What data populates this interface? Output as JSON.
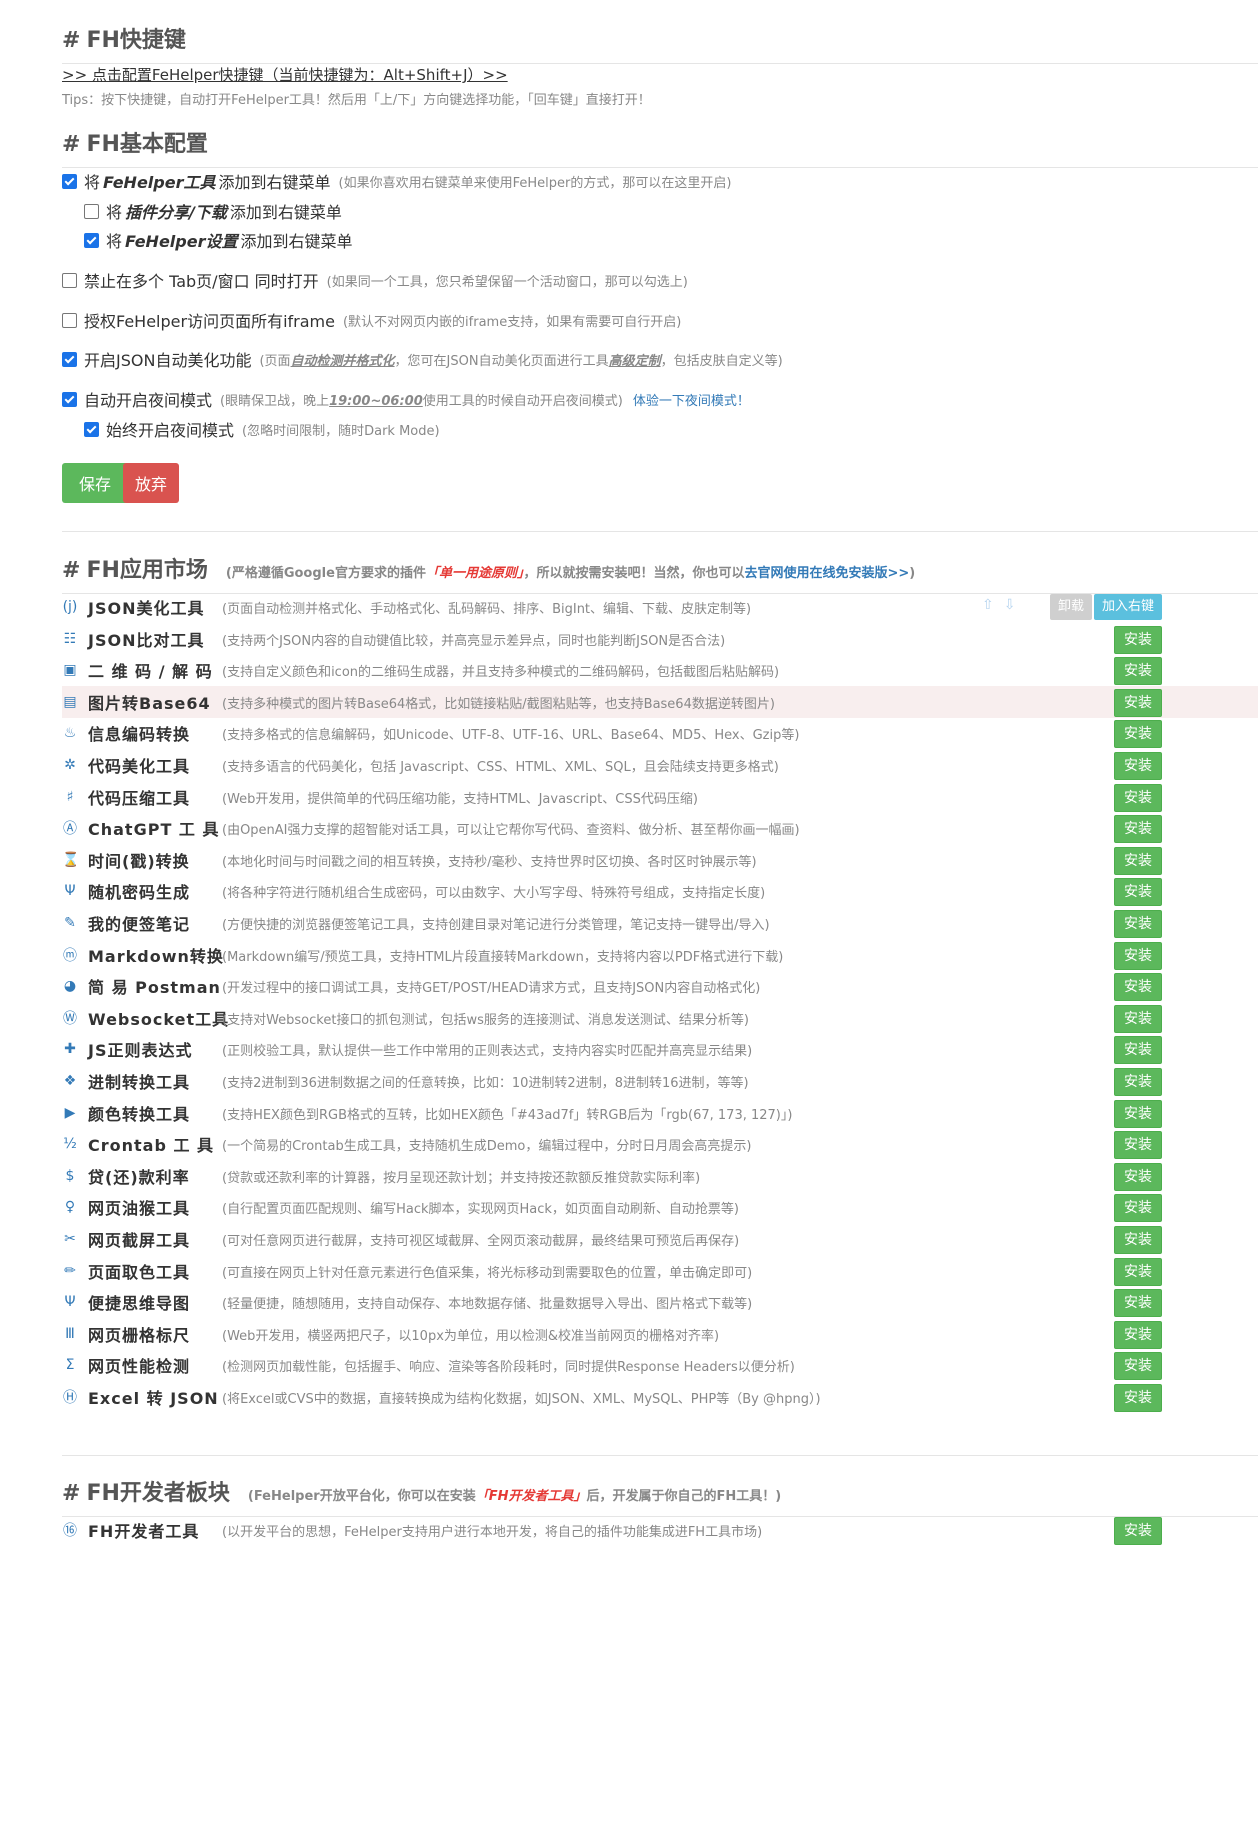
{
  "hotkey": {
    "header_title": "FH快捷键",
    "link": ">> 点击配置FeHelper快捷键（当前快捷键为：Alt+Shift+J）>>",
    "tips": "Tips：按下快捷键，自动打开FeHelper工具！然后用「上/下」方向键选择功能，「回车键」直接打开！"
  },
  "basic": {
    "header_title": "FH基本配置",
    "options": {
      "ctx_menu": {
        "checked": true,
        "pre": "将",
        "em": "FeHelper工具",
        "post": "添加到右键菜单",
        "note": "(如果你喜欢用右键菜单来使用FeHelper的方式，那可以在这里开启)"
      },
      "ctx_share": {
        "checked": false,
        "pre": "将",
        "em": "插件分享/下载",
        "post": "添加到右键菜单"
      },
      "ctx_settings": {
        "checked": true,
        "pre": "将",
        "em": "FeHelper设置",
        "post": "添加到右键菜单"
      },
      "no_multi_tab": {
        "checked": false,
        "label": "禁止在多个 Tab页/窗口 同时打开",
        "note": "(如果同一个工具，您只希望保留一个活动窗口，那可以勾选上)"
      },
      "iframe": {
        "checked": false,
        "label": "授权FeHelper访问页面所有iframe",
        "note": "(默认不对网页内嵌的iframe支持，如果有需要可自行开启)"
      },
      "json_auto": {
        "checked": true,
        "label": "开启JSON自动美化功能",
        "note_a": "(页面",
        "note_b": "自动检测并格式化",
        "note_c": "，您可在JSON自动美化页面进行工具",
        "note_d": "高级定制",
        "note_e": "，包括皮肤自定义等)"
      },
      "night_auto": {
        "checked": true,
        "label": "自动开启夜间模式",
        "note_a": "(眼睛保卫战，晚上",
        "note_b": "19:00~06:00",
        "note_c": "使用工具的时候自动开启夜间模式)",
        "link": "体验一下夜间模式！"
      },
      "night_always": {
        "checked": true,
        "label": "始终开启夜间模式",
        "note": "(忽略时间限制，随时Dark Mode)"
      }
    },
    "save_label": "保存",
    "cancel_label": "放弃"
  },
  "market": {
    "header_title": "FH应用市场",
    "sub_a": "(严格遵循Google官方要求的插件",
    "sub_red": "「单一用途原则」",
    "sub_b": "，所以就按需安装吧！当然，你也可以",
    "sub_link": "去官网使用在线免安装版>>",
    "sub_c": ")",
    "uninstall_label": "卸载",
    "add_ctx_label": "加入右键",
    "install_label": "安装",
    "tools": [
      {
        "icon": "(j)",
        "name": "JSON美化工具",
        "desc": "(页面自动检测并格式化、手动格式化、乱码解码、排序、BigInt、编辑、下载、皮肤定制等)",
        "installed": true
      },
      {
        "icon": "☷",
        "name": "JSON比对工具",
        "desc": "(支持两个JSON内容的自动键值比较，并高亮显示差异点，同时也能判断JSON是否合法)"
      },
      {
        "icon": "▣",
        "name": "二 维 码 / 解 码",
        "desc": "(支持自定义颜色和icon的二维码生成器，并且支持多种模式的二维码解码，包括截图后粘贴解码)"
      },
      {
        "icon": "▤",
        "name": "图片转Base64",
        "desc": "(支持多种模式的图片转Base64格式，比如链接粘贴/截图粘贴等，也支持Base64数据逆转图片)",
        "highlight": true
      },
      {
        "icon": "♨",
        "name": "信息编码转换",
        "desc": "(支持多格式的信息编解码，如Unicode、UTF-8、UTF-16、URL、Base64、MD5、Hex、Gzip等)"
      },
      {
        "icon": "✲",
        "name": "代码美化工具",
        "desc": "(支持多语言的代码美化，包括 Javascript、CSS、HTML、XML、SQL，且会陆续支持更多格式)"
      },
      {
        "icon": "♯",
        "name": "代码压缩工具",
        "desc": "(Web开发用，提供简单的代码压缩功能，支持HTML、Javascript、CSS代码压缩)"
      },
      {
        "icon": "Ⓐ",
        "name": "ChatGPT 工 具",
        "desc": "(由OpenAI强力支撑的超智能对话工具，可以让它帮你写代码、查资料、做分析、甚至帮你画一幅画)"
      },
      {
        "icon": "⌛",
        "name": "时间(戳)转换",
        "desc": "(本地化时间与时间戳之间的相互转换，支持秒/毫秒、支持世界时区切换、各时区时钟展示等)"
      },
      {
        "icon": "Ψ",
        "name": "随机密码生成",
        "desc": "(将各种字符进行随机组合生成密码，可以由数字、大小写字母、特殊符号组成，支持指定长度)"
      },
      {
        "icon": "✎",
        "name": "我的便签笔记",
        "desc": "(方便快捷的浏览器便签笔记工具，支持创建目录对笔记进行分类管理，笔记支持一键导出/导入)"
      },
      {
        "icon": "ⓜ",
        "name": "Markdown转换",
        "desc": "(Markdown编写/预览工具，支持HTML片段直接转Markdown，支持将内容以PDF格式进行下载)"
      },
      {
        "icon": "◕",
        "name": "简 易 Postman",
        "desc": "(开发过程中的接口调试工具，支持GET/POST/HEAD请求方式，且支持JSON内容自动格式化)"
      },
      {
        "icon": "Ⓦ",
        "name": "Websocket工具",
        "desc": "(支持对Websocket接口的抓包测试，包括ws服务的连接测试、消息发送测试、结果分析等)"
      },
      {
        "icon": "✚",
        "name": "JS正则表达式",
        "desc": "(正则校验工具，默认提供一些工作中常用的正则表达式，支持内容实时匹配并高亮显示结果)"
      },
      {
        "icon": "❖",
        "name": "进制转换工具",
        "desc": "(支持2进制到36进制数据之间的任意转换，比如：10进制转2进制，8进制转16进制，等等)"
      },
      {
        "icon": "▶",
        "name": "颜色转换工具",
        "desc": "(支持HEX颜色到RGB格式的互转，比如HEX颜色「#43ad7f」转RGB后为「rgb(67, 173, 127)」)"
      },
      {
        "icon": "½",
        "name": "Crontab 工 具",
        "desc": "(一个简易的Crontab生成工具，支持随机生成Demo，编辑过程中，分时日月周会高亮提示)"
      },
      {
        "icon": "$",
        "name": "贷(还)款利率",
        "desc": "(贷款或还款利率的计算器，按月呈现还款计划；并支持按还款额反推贷款实际利率)"
      },
      {
        "icon": "♀",
        "name": "网页油猴工具",
        "desc": "(自行配置页面匹配规则、编写Hack脚本，实现网页Hack，如页面自动刷新、自动抢票等)"
      },
      {
        "icon": "✂",
        "name": "网页截屏工具",
        "desc": "(可对任意网页进行截屏，支持可视区域截屏、全网页滚动截屏，最终结果可预览后再保存)"
      },
      {
        "icon": "✏",
        "name": "页面取色工具",
        "desc": "(可直接在网页上针对任意元素进行色值采集，将光标移动到需要取色的位置，单击确定即可)"
      },
      {
        "icon": "Ψ",
        "name": "便捷思维导图",
        "desc": "(轻量便捷，随想随用，支持自动保存、本地数据存储、批量数据导入导出、图片格式下载等)"
      },
      {
        "icon": "Ⅲ",
        "name": "网页栅格标尺",
        "desc": "(Web开发用，横竖两把尺子，以10px为单位，用以检测&校准当前网页的栅格对齐率)"
      },
      {
        "icon": "Σ",
        "name": "网页性能检测",
        "desc": "(检测网页加载性能，包括握手、响应、渲染等各阶段耗时，同时提供Response Headers以便分析)"
      },
      {
        "icon": "Ⓗ",
        "name": "Excel 转 JSON",
        "desc": "(将Excel或CVS中的数据，直接转换成为结构化数据，如JSON、XML、MySQL、PHP等（By @hpng）)"
      }
    ]
  },
  "dev": {
    "header_title": "FH开发者板块",
    "sub_a": "(FeHelper开放平台化，你可以在安装",
    "sub_red": "「FH开发者工具」",
    "sub_b": "后，开发属于你自己的FH工具！)",
    "tool": {
      "icon": "⑯",
      "name": "FH开发者工具",
      "desc": "(以开发平台的思想，FeHelper支持用户进行本地开发，将自己的插件功能集成进FH工具市场)"
    },
    "install_label": "安装"
  },
  "colors": {
    "install": "#5cb85c",
    "save": "#5cb85c",
    "cancel": "#d9534f",
    "link": "#337ab7",
    "add_ctx": "#5bc0de"
  }
}
